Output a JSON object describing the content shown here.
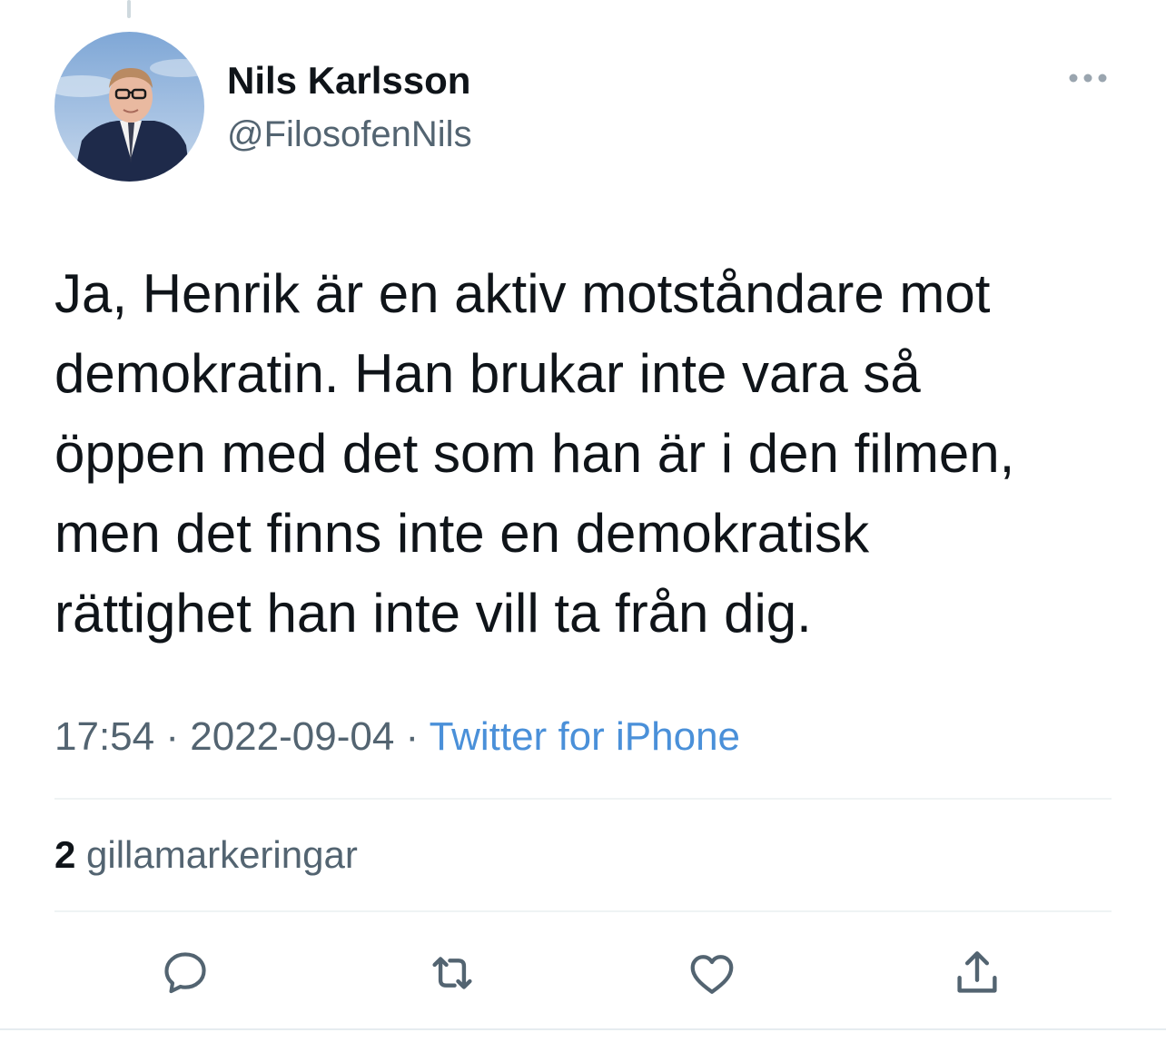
{
  "tweet": {
    "author": {
      "name": "Nils Karlsson",
      "handle": "@FilosofenNils",
      "avatar": "profile-photo"
    },
    "text": "Ja, Henrik är en aktiv motståndare mot\ndemokratin. Han brukar inte vara så\nöppen med det som han är i den filmen,\nmen det finns inte en demokratisk\nrättighet han inte vill ta från dig.",
    "time": "17:54",
    "date": "2022-09-04",
    "separator": "·",
    "source": "Twitter for iPhone",
    "likes": {
      "count": "2",
      "label": "gillamarkeringar"
    }
  },
  "actions": {
    "reply_icon": "reply-icon",
    "retweet_icon": "retweet-icon",
    "like_icon": "heart-icon",
    "share_icon": "share-icon"
  },
  "colors": {
    "text": "#0f1419",
    "secondary": "#536471",
    "link": "#1d9bf0",
    "divider": "#eff3f4",
    "icon": "#536471"
  }
}
